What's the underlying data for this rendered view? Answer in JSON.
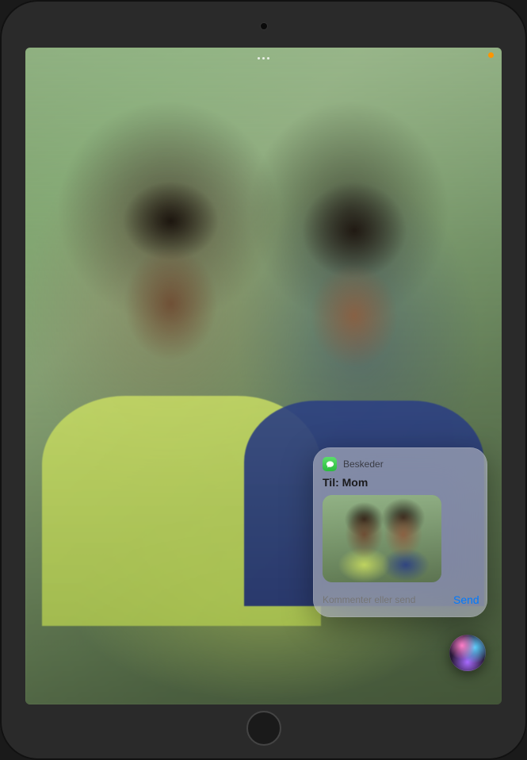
{
  "status": {
    "privacy_indicator": "microphone-active"
  },
  "siri_card": {
    "app_name": "Beskeder",
    "recipient_prefix": "Til:",
    "recipient_name": "Mom",
    "comment_placeholder": "Kommenter eller send",
    "send_label": "Send"
  }
}
